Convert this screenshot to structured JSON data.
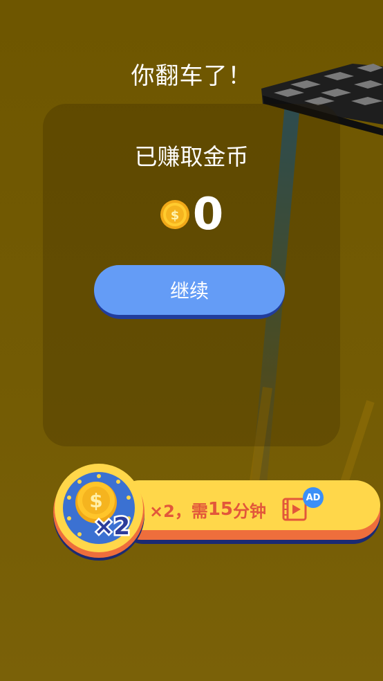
{
  "result": {
    "title": "你翻车了！",
    "earned_label": "已赚取金币",
    "coin_count": "0",
    "continue_label": "继续"
  },
  "double_offer": {
    "multiplier_badge": "×2",
    "text_prefix": "×2，需",
    "minutes": "15",
    "text_suffix": "分钟",
    "ad_badge": "AD"
  },
  "icons": {
    "coin": "dollar-coin-icon",
    "video": "video-play-icon",
    "medal": "coin-medal-icon"
  },
  "colors": {
    "background": "#735b04",
    "button_blue": "#649cf6",
    "offer_yellow": "#ffd74a",
    "offer_text": "#e2573a",
    "ad_blue": "#3b8ff7"
  }
}
